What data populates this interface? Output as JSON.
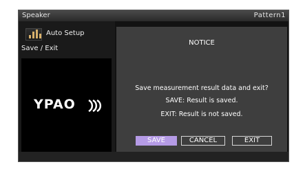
{
  "titlebar": {
    "title": "Speaker",
    "pattern": "Pattern1"
  },
  "sidebar": {
    "menu_item": {
      "label": "Auto Setup",
      "icon": "speaker-levels-icon"
    },
    "sub_label": "Save / Exit",
    "logo": {
      "text": "YPAO"
    }
  },
  "dialog": {
    "title": "NOTICE",
    "question": "Save measurement result data and exit?",
    "save_info": "SAVE: Result is saved.",
    "exit_info": "EXIT: Result is not saved.",
    "buttons": {
      "save": "SAVE",
      "cancel": "CANCEL",
      "exit": "EXIT"
    },
    "selected_button": "save"
  },
  "colors": {
    "selected_button": "#b59be6",
    "icon_accent": "#d7b06b"
  }
}
